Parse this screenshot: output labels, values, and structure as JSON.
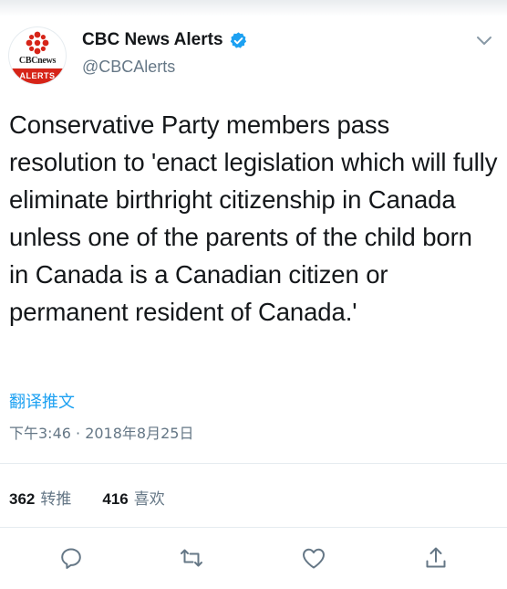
{
  "account": {
    "display_name": "CBC News Alerts",
    "handle": "@CBCAlerts",
    "avatar_brand_text": "CBCnews",
    "avatar_badge_text": "ALERTS"
  },
  "tweet": {
    "text": "Conservative Party members pass resolution to 'enact legislation which will fully eliminate birthright citizenship in Canada unless one of the parents of the child born in Canada is a Canadian citizen or permanent resident of Canada.'",
    "translate_label": "翻译推文",
    "timestamp": "下午3:46 · 2018年8月25日"
  },
  "stats": {
    "retweets_count": "362",
    "retweets_label": "转推",
    "likes_count": "416",
    "likes_label": "喜欢"
  },
  "icons": {
    "verified": "verified-badge-icon",
    "menu": "chevron-down-icon",
    "reply": "reply-icon",
    "retweet": "retweet-icon",
    "like": "heart-icon",
    "share": "share-icon"
  },
  "colors": {
    "accent": "#1da1f2",
    "muted": "#657786",
    "brand_red": "#d62418"
  }
}
